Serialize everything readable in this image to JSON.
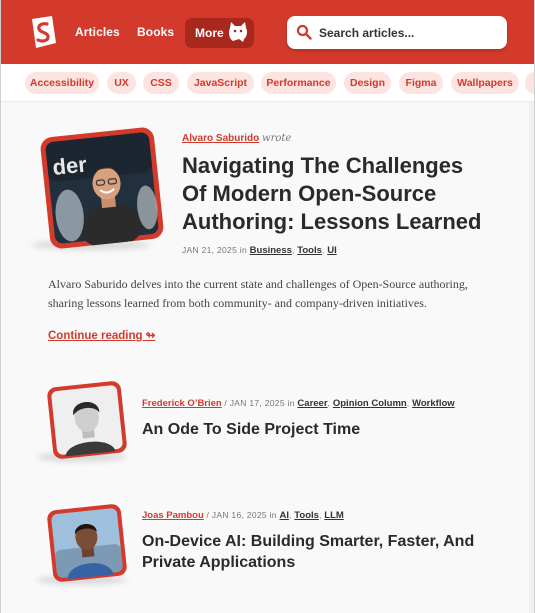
{
  "header": {
    "nav": [
      "Articles",
      "Books"
    ],
    "more_label": "More",
    "search_placeholder": "Search articles..."
  },
  "tags": [
    "Accessibility",
    "UX",
    "CSS",
    "JavaScript",
    "Performance",
    "Design",
    "Figma",
    "Wallpapers"
  ],
  "articles": [
    {
      "author": "Alvaro Saburido",
      "wrote": "wrote",
      "title_lines": [
        "Navigating The Challenges",
        "Of Modern Open-Source",
        "Authoring: Lessons Learned"
      ],
      "date": "JAN 21, 2025",
      "in": "in",
      "categories": [
        "Business",
        "Tools",
        "UI"
      ],
      "excerpt_lines": [
        "Alvaro Saburido delves into the current state and challenges of Open-Source authoring,",
        "sharing lessons learned from both community- and company-driven initiatives."
      ],
      "continue": "Continue reading ↬",
      "thumb_text": "der"
    },
    {
      "author": "Frederick O’Brien",
      "sep": "/",
      "date": "JAN 17, 2025",
      "in": "in",
      "categories": [
        "Career",
        "Opinion Column",
        "Workflow"
      ],
      "title": "An Ode To Side Project Time"
    },
    {
      "author": "Joas Pambou",
      "sep": "/",
      "date": "JAN 16, 2025",
      "in": "in",
      "categories": [
        "AI",
        "Tools",
        "LLM"
      ],
      "title_lines": [
        "On-Device AI: Building Smarter, Faster, And",
        "Private Applications"
      ]
    }
  ],
  "colors": {
    "brand": "#d33a2c",
    "brand_dark": "#a8281d",
    "tag_bg": "#fde4e1"
  }
}
